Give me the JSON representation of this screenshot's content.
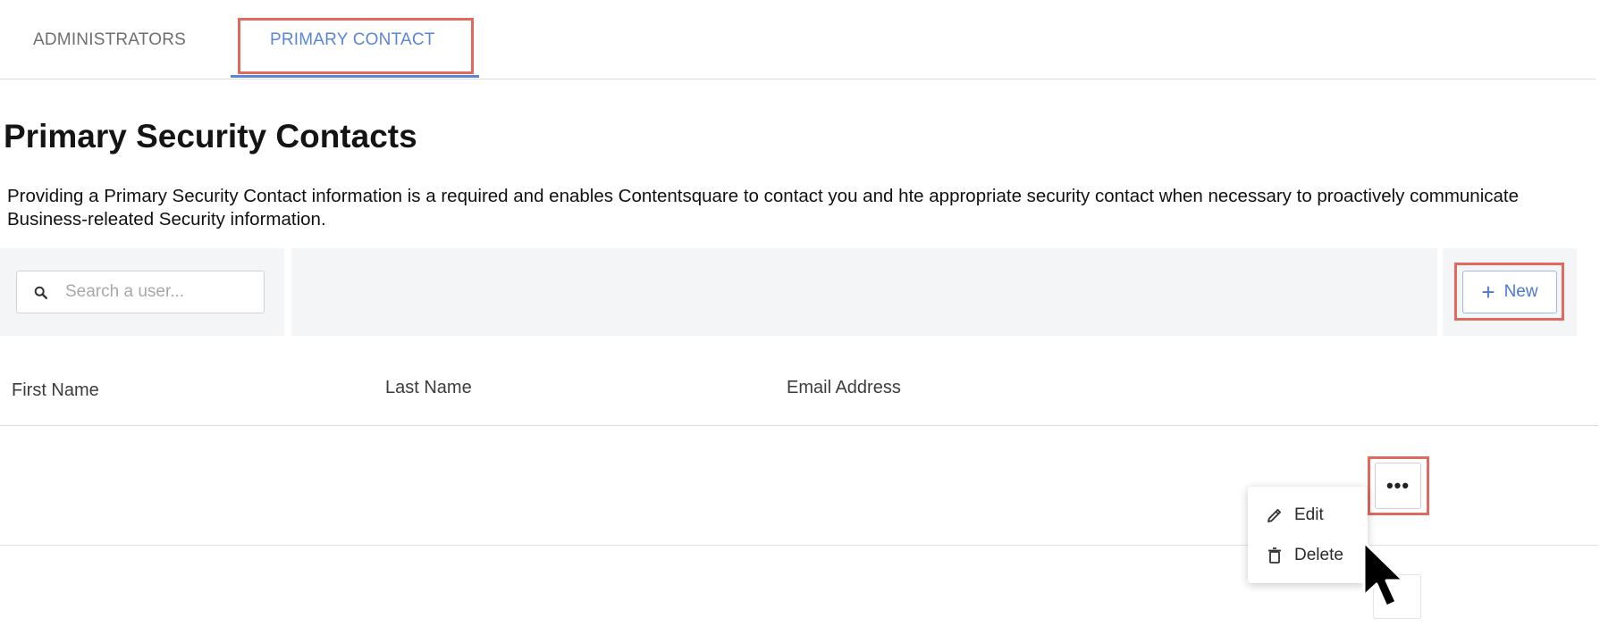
{
  "tabs": [
    {
      "label": "ADMINISTRATORS",
      "active": false
    },
    {
      "label": "PRIMARY CONTACT",
      "active": true
    }
  ],
  "page": {
    "title": "Primary Security Contacts",
    "description": "Providing a Primary Security Contact information is a required and enables Contentsquare to contact you and hte appropriate security contact when necessary to proactively communicate Business-releated Security information."
  },
  "toolbar": {
    "search_placeholder": "Search a user...",
    "search_value": "",
    "new_label": "New",
    "search_icon": "search-icon",
    "new_icon": "plus-icon"
  },
  "table": {
    "columns": [
      "First Name",
      "Last Name",
      "Email Address"
    ],
    "rows": [
      {
        "first_name": "",
        "last_name": "",
        "email": ""
      }
    ]
  },
  "row_menu": {
    "trigger_label": "•••",
    "items": [
      {
        "label": "Edit",
        "icon": "pencil-icon"
      },
      {
        "label": "Delete",
        "icon": "trash-icon"
      }
    ]
  },
  "colors": {
    "accent": "#5b86d6",
    "highlight": "#e06a60",
    "band": "#f4f5f7"
  }
}
